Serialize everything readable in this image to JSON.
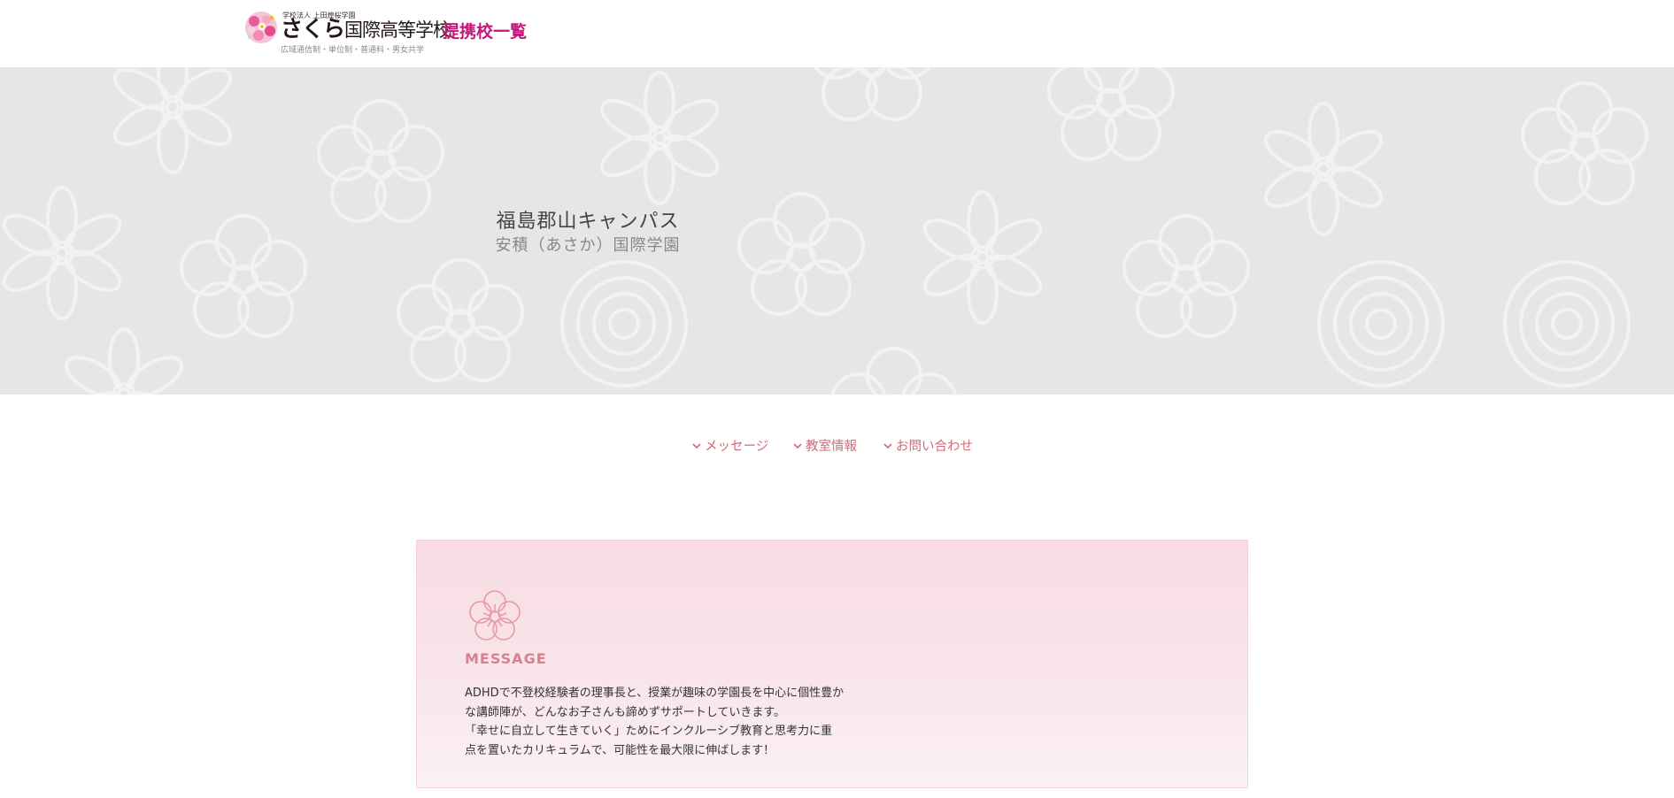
{
  "header": {
    "logo_corp": "学校法人 上田煌桜学園",
    "logo_sakura": "さくら",
    "logo_school": "国際高等学校",
    "logo_tagline": "広域通信制・単位制・普通科・男女共学",
    "partner_link": "提携校一覧"
  },
  "hero": {
    "title": "福島郡山キャンパス",
    "subtitle": "安積（あさか）国際学園"
  },
  "subnav": {
    "items": [
      {
        "label": "メッセージ",
        "icon": "chevron-down-icon"
      },
      {
        "label": "教室情報",
        "icon": "chevron-down-icon"
      },
      {
        "label": "お問い合わせ",
        "icon": "chevron-down-icon"
      }
    ]
  },
  "message": {
    "icon": "sakura-flower-icon",
    "heading": "MESSAGE",
    "lines": [
      "ADHDで不登校経験者の理事長と、授業が趣味の学園長を中心に個性豊か",
      "な講師陣が、どんなお子さんも諦めずサポートしていきます。",
      "「幸せに自立して生きていく」ためにインクルーシブ教育と思考力に重",
      "点を置いたカリキュラムで、可能性を最大限に伸ばします！"
    ]
  },
  "colors": {
    "accent": "#c2187a",
    "nav": "#d06a78",
    "hero_bg": "#e6e6e5",
    "card_bg": "#f9dbe3"
  }
}
